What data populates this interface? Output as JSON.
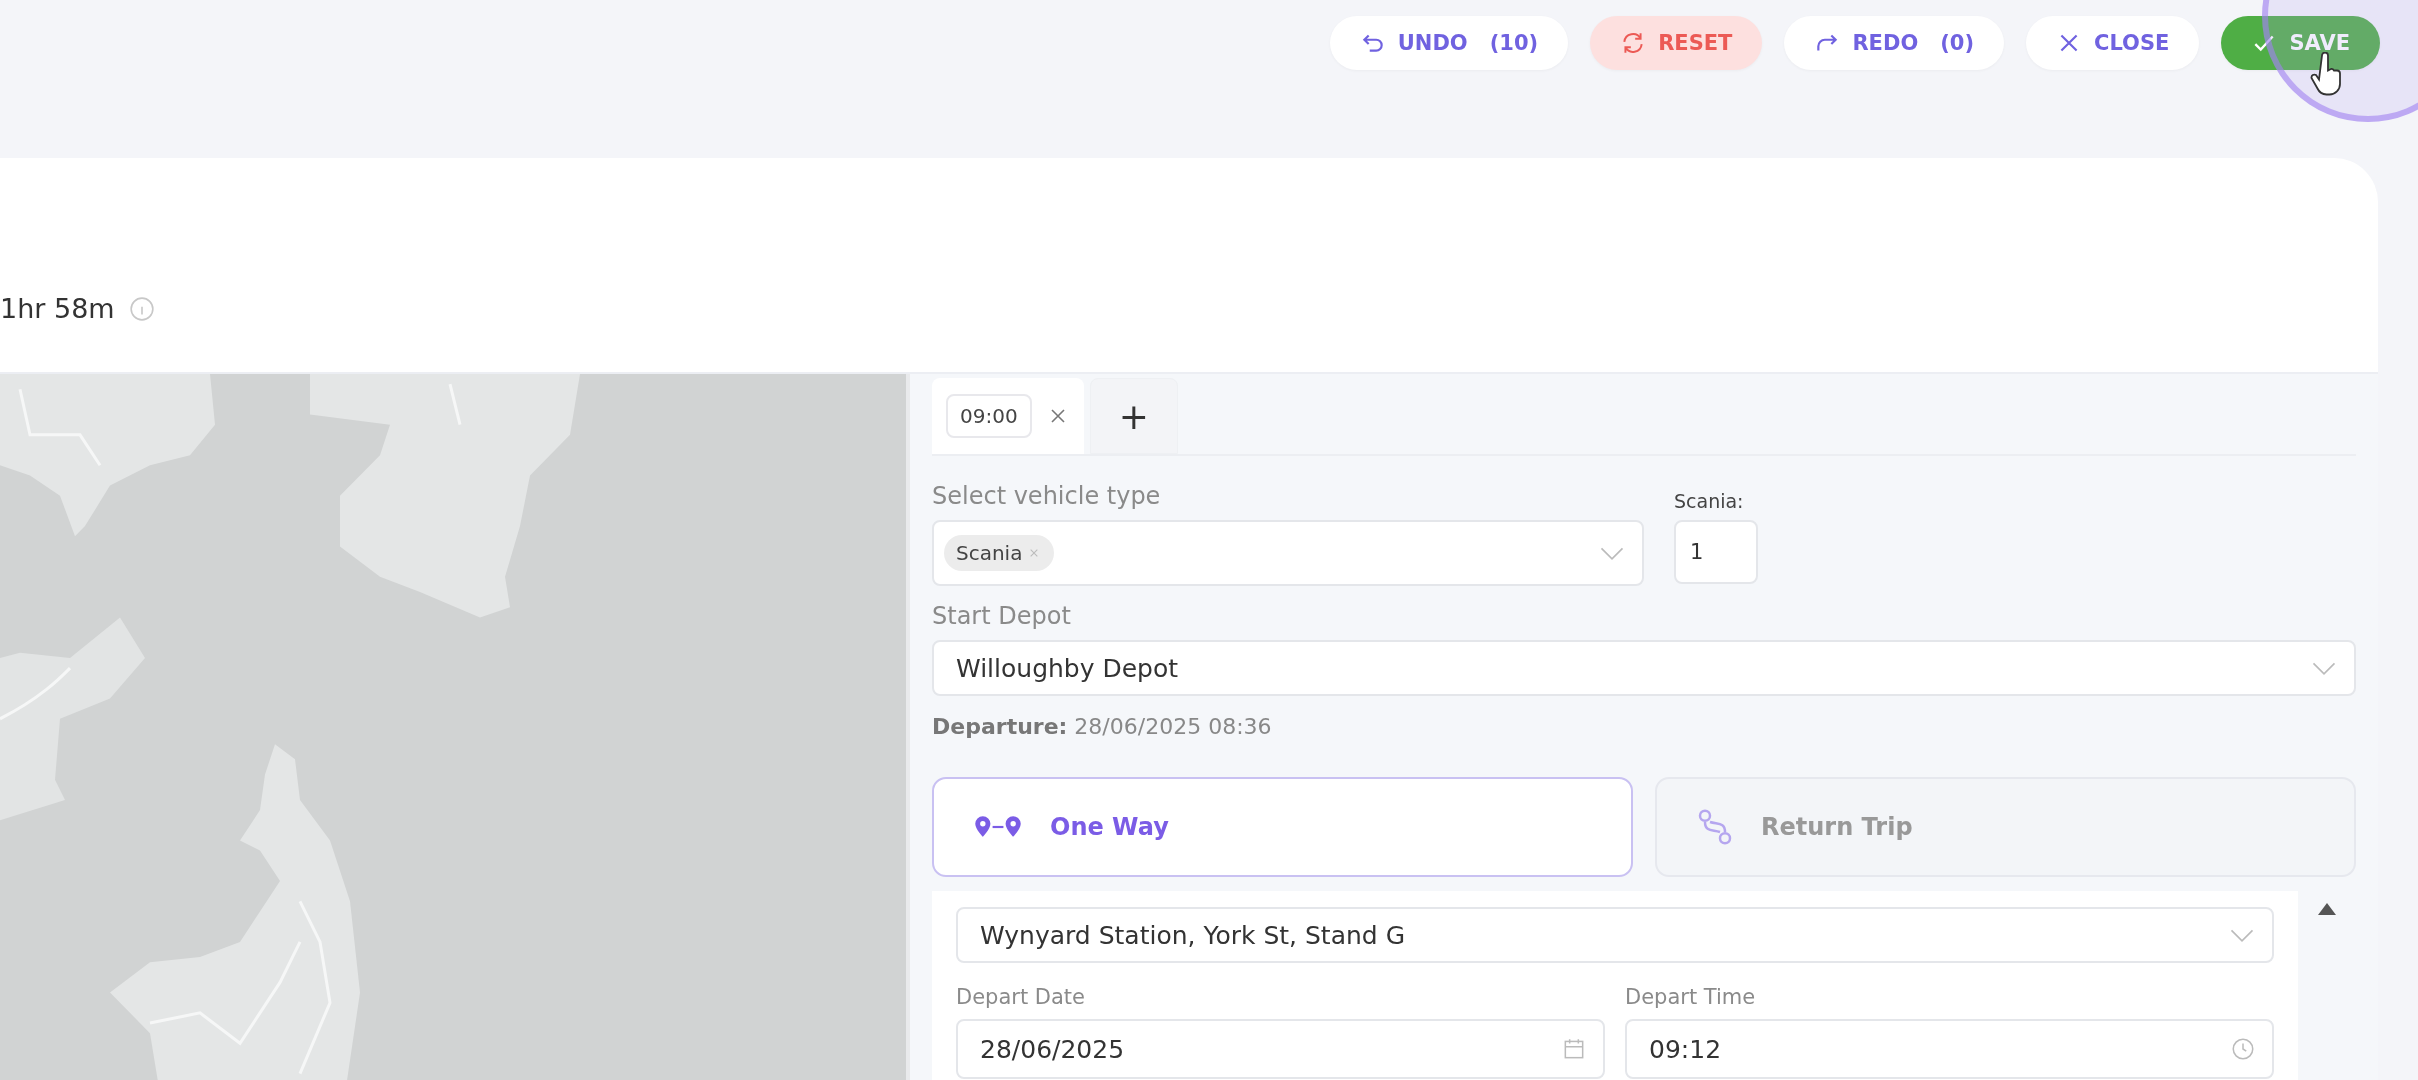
{
  "toolbar": {
    "buttons": [
      {
        "kind": "undo",
        "label": "UNDO",
        "count": "(10)"
      },
      {
        "kind": "reset",
        "label": "RESET"
      },
      {
        "kind": "redo",
        "label": "REDO",
        "count": "(0)"
      },
      {
        "kind": "close",
        "label": "CLOSE"
      },
      {
        "kind": "save",
        "label": "SAVE"
      }
    ]
  },
  "summary": {
    "duration": "1hr 58m"
  },
  "trip_tabs": [
    {
      "label": "09:00",
      "selected": true
    }
  ],
  "add_tab": "+",
  "vehicle": {
    "label": "Select vehicle type",
    "chips": [
      "Scania"
    ],
    "count_label": "Scania:",
    "count_value": "1"
  },
  "start_depot": {
    "label": "Start Depot",
    "value": "Willoughby Depot"
  },
  "departure": {
    "label": "Departure:",
    "value": "28/06/2025 08:36"
  },
  "trip_types": [
    {
      "kind": "one_way",
      "label": "One Way",
      "selected": true
    },
    {
      "kind": "return",
      "label": "Return Trip",
      "selected": false
    }
  ],
  "stop": {
    "location": "Wynyard Station, York St, Stand G",
    "date_label": "Depart Date",
    "date": "28/06/2025",
    "time_label": "Depart Time",
    "time": "09:12"
  }
}
